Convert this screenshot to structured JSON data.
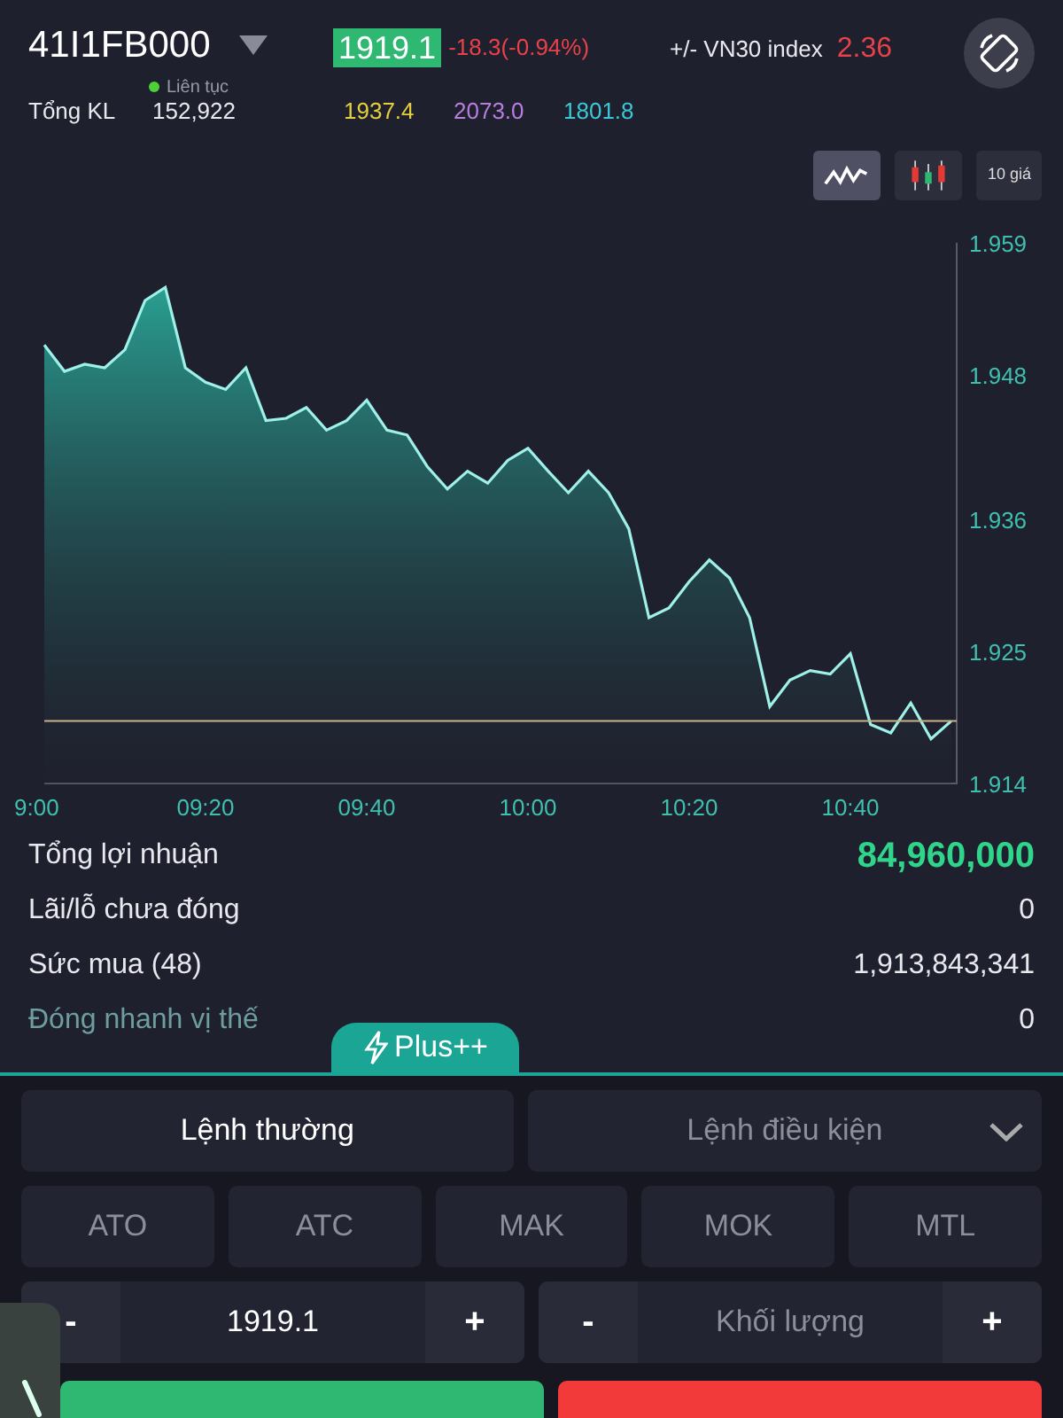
{
  "header": {
    "symbol": "41I1FB000",
    "session": {
      "label": "Liên tục",
      "color": "#4cd137"
    },
    "price": "1919.1",
    "change": "-18.3(-0.94%)",
    "index_label": "+/- VN30 index",
    "index_value": "2.36"
  },
  "volume": {
    "label": "Tổng KL",
    "value": "152,922"
  },
  "price_levels": [
    {
      "value": "1937.4",
      "color": "#e5cf3c"
    },
    {
      "value": "2073.0",
      "color": "#b77ee0"
    },
    {
      "value": "1801.8",
      "color": "#3cc8d8"
    }
  ],
  "chart_modes": [
    {
      "kind": "line",
      "selected": true
    },
    {
      "kind": "candle",
      "selected": false
    },
    {
      "kind": "text",
      "label": "10 giá",
      "selected": false
    }
  ],
  "chart": {
    "chart_data": {
      "type": "area",
      "categories": [
        "9:00",
        null,
        null,
        null,
        null,
        null,
        null,
        null,
        "09:20",
        null,
        null,
        null,
        null,
        null,
        null,
        null,
        "09:40",
        null,
        null,
        null,
        null,
        null,
        null,
        null,
        "10:00",
        null,
        null,
        null,
        null,
        null,
        null,
        null,
        "10:20",
        null,
        null,
        null,
        null,
        null,
        null,
        null,
        "10:40",
        null,
        null,
        null,
        null,
        null
      ],
      "series": [
        {
          "color": "#9ff0e8",
          "values": [
            1.9505,
            1.9483,
            1.9489,
            1.9486,
            1.9501,
            1.9542,
            1.9553,
            1.9486,
            1.9474,
            1.9468,
            1.9486,
            1.9442,
            1.9444,
            1.9453,
            1.9434,
            1.9442,
            1.9459,
            1.9434,
            1.943,
            1.9404,
            1.9385,
            1.94,
            1.939,
            1.9409,
            1.9419,
            1.94,
            1.9382,
            1.94,
            1.9382,
            1.9352,
            1.9278,
            1.9286,
            1.9308,
            1.9326,
            1.9311,
            1.9278,
            1.9204,
            1.9226,
            1.9234,
            1.9231,
            1.9248,
            1.9189,
            1.9182,
            1.9207,
            1.9177,
            1.9192
          ]
        }
      ],
      "ylim": [
        1.914,
        1.959
      ],
      "ref_lines": [
        {
          "axis": "y",
          "value": 1.9192
        }
      ],
      "yticks": [
        {
          "value": 1.914,
          "label": "1.914"
        },
        {
          "value": 1.925,
          "label": "1.925"
        },
        {
          "value": 1.936,
          "label": "1.936"
        },
        {
          "value": 1.948,
          "label": "1.948"
        },
        {
          "value": 1.959,
          "label": "1.959"
        }
      ]
    }
  },
  "summary": [
    {
      "kind": "profit",
      "label": "Tổng lợi nhuận",
      "value": "84,960,000"
    },
    {
      "kind": "plain",
      "label": "Lãi/lỗ chưa đóng",
      "value": "0"
    },
    {
      "kind": "plain",
      "label": "Sức mua (48)",
      "value": "1,913,843,341"
    },
    {
      "kind": "action",
      "label": "Đóng nhanh vị thế",
      "value": "0"
    }
  ],
  "plus_tab": {
    "label": "Plus++"
  },
  "order_tabs": [
    {
      "label": "Lệnh thường",
      "selected": true,
      "dropdown": false
    },
    {
      "label": "Lệnh điều kiện",
      "selected": false,
      "dropdown": true
    }
  ],
  "price_types": [
    "ATO",
    "ATC",
    "MAK",
    "MOK",
    "MTL"
  ],
  "price_field": {
    "minus": "-",
    "value": "1919.1",
    "plus": "+"
  },
  "quantity_field": {
    "minus": "-",
    "placeholder": "Khối lượng",
    "plus": "+"
  },
  "action_buttons": [
    {
      "kind": "buy"
    },
    {
      "kind": "sell"
    }
  ]
}
